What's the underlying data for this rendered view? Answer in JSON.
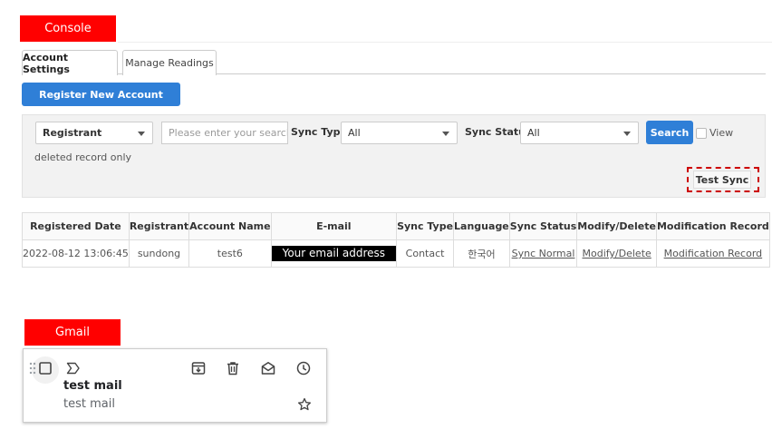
{
  "labels": {
    "console": "Console",
    "gmail": "Gmail"
  },
  "tabs": [
    {
      "label": "Account Settings",
      "active": true
    },
    {
      "label": "Manage Readings",
      "active": false
    }
  ],
  "actions": {
    "register_label": "Register New Account"
  },
  "filters": {
    "search_type": "Registrant",
    "search_placeholder": "Please enter your search term",
    "sync_type_label": "Sync Type",
    "sync_type_value": "All",
    "sync_status_label": "Sync Status",
    "sync_status_value": "All",
    "search_button": "Search",
    "view_label": "View",
    "deleted_label": "deleted record only",
    "test_sync_label": "Test Sync"
  },
  "table": {
    "headers": [
      "Registered Date",
      "Registrant",
      "Account Name",
      "E-mail",
      "Sync Type",
      "Language",
      "Sync Status",
      "Modify/Delete",
      "Modification Record"
    ],
    "rows": [
      {
        "registered_date": "2022-08-12 13:06:45",
        "registrant": "sundong",
        "account_name": "test6",
        "email": "Your email address",
        "sync_type": "Contact",
        "language": "한국어",
        "sync_status": "Sync Normal",
        "modify_delete": "Modify/Delete",
        "modification_record": "Modification Record"
      }
    ]
  },
  "gmail": {
    "sender": "test mail",
    "subject": "test mail"
  },
  "colors": {
    "accent": "#2f7fd7",
    "label_red": "#ff0000",
    "highlight_dash": "#cc0000"
  },
  "icons": [
    "drag-handle-icon",
    "checkbox-icon",
    "important-marker-icon",
    "archive-icon",
    "delete-icon",
    "mark-unread-icon",
    "snooze-icon",
    "star-icon"
  ]
}
